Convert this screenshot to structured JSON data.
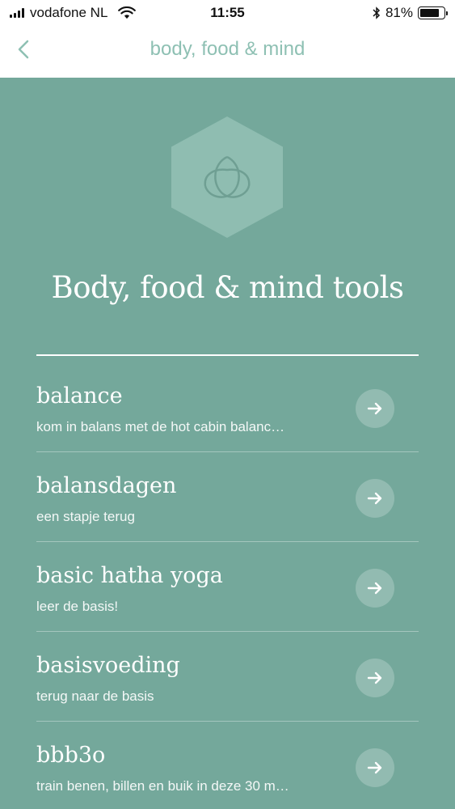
{
  "status_bar": {
    "carrier": "vodafone NL",
    "time": "11:55",
    "battery": "81%",
    "battery_level": 0.81,
    "icons": [
      "signal-icon",
      "wifi-icon",
      "bluetooth-icon",
      "battery-icon"
    ]
  },
  "nav": {
    "title": "body, food & mind",
    "back_icon": "chevron-left-icon"
  },
  "hero": {
    "logo_icon": "trinity-knot-icon",
    "title": "Body, food & mind tools"
  },
  "items": [
    {
      "title": "balance",
      "subtitle": "kom in balans met de hot cabin balanc…",
      "icon": "arrow-right-icon"
    },
    {
      "title": "balansdagen",
      "subtitle": "een stapje terug",
      "icon": "arrow-right-icon"
    },
    {
      "title": "basic hatha yoga",
      "subtitle": "leer de basis!",
      "icon": "arrow-right-icon"
    },
    {
      "title": "basisvoeding",
      "subtitle": "terug naar de basis",
      "icon": "arrow-right-icon"
    },
    {
      "title": "bbb3o",
      "subtitle": "train benen, billen en buik in deze 30 m…",
      "icon": "arrow-right-icon"
    }
  ],
  "colors": {
    "background": "#74a89b",
    "nav_title": "#8ec0b3",
    "hexagon": "#8fbdb1",
    "white": "#ffffff"
  }
}
